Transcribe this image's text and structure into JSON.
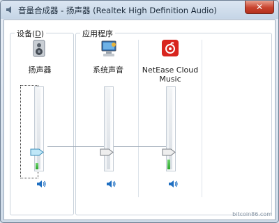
{
  "window": {
    "title": "音量合成器 - 扬声器 (Realtek High Definition Audio)",
    "close_glyph": "✕"
  },
  "device_group": {
    "label_text": "设备(",
    "label_key": "D",
    "label_end": ")",
    "channel": {
      "name": "扬声器",
      "volume_level": 0.22,
      "meter_level": 0.08,
      "icon": "speakers-device-icon"
    }
  },
  "apps_group": {
    "label": "应用程序",
    "channels": [
      {
        "name": "系统声音",
        "volume_level": 0.22,
        "meter_level": 0.0,
        "icon": "system-sounds-icon"
      },
      {
        "name": "NetEase Cloud\nMusic",
        "volume_level": 0.22,
        "meter_level": 0.12,
        "icon": "netease-cloud-music-icon"
      }
    ]
  },
  "colors": {
    "netease_red": "#d8251e",
    "meter_green": "#2aa52a",
    "mute_icon_blue": "#1f6fc2"
  },
  "watermark": "bitcoin86.com"
}
